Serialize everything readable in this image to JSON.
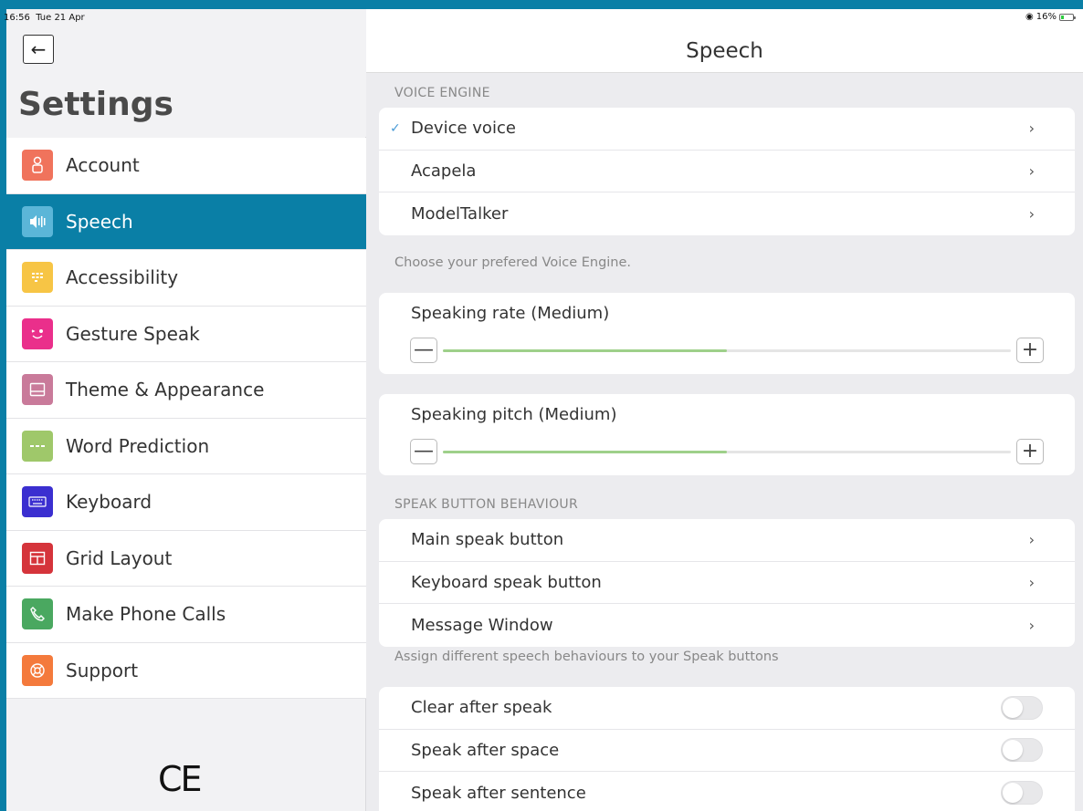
{
  "status_bar": {
    "time": "16:56",
    "date": "Tue 21 Apr",
    "battery": "16%",
    "wifi_icon": "wifi-icon"
  },
  "sidebar": {
    "title": "Settings",
    "items": [
      {
        "label": "Account",
        "icon": "person-icon",
        "color": "#f0735c",
        "active": false
      },
      {
        "label": "Speech",
        "icon": "speaker-icon",
        "color": "#5bb6d8",
        "active": true
      },
      {
        "label": "Accessibility",
        "icon": "grid-dots-icon",
        "color": "#f7c545",
        "active": false
      },
      {
        "label": "Gesture Speak",
        "icon": "wink-face-icon",
        "color": "#ea2f8b",
        "active": false
      },
      {
        "label": "Theme & Appearance",
        "icon": "window-icon",
        "color": "#c97a9a",
        "active": false
      },
      {
        "label": "Word Prediction",
        "icon": "dots-icon",
        "color": "#9fc86a",
        "active": false
      },
      {
        "label": "Keyboard",
        "icon": "keyboard-icon",
        "color": "#3b2fd0",
        "active": false
      },
      {
        "label": "Grid Layout",
        "icon": "table-icon",
        "color": "#d5343b",
        "active": false
      },
      {
        "label": "Make Phone Calls",
        "icon": "phone-icon",
        "color": "#4aa860",
        "active": false
      },
      {
        "label": "Support",
        "icon": "lifebuoy-icon",
        "color": "#f47a3c",
        "active": false
      }
    ],
    "ce_mark": "CE"
  },
  "main": {
    "title": "Speech",
    "voice_engine": {
      "section": "VOICE ENGINE",
      "items": [
        {
          "label": "Device voice",
          "checked": true
        },
        {
          "label": "Acapela",
          "checked": false
        },
        {
          "label": "ModelTalker",
          "checked": false
        }
      ],
      "caption": "Choose your prefered Voice Engine."
    },
    "speaking_rate": {
      "label": "Speaking rate (Medium)",
      "level": 0.5
    },
    "speaking_pitch": {
      "label": "Speaking pitch (Medium)",
      "level": 0.5
    },
    "speak_button": {
      "section": "SPEAK BUTTON BEHAVIOUR",
      "items": [
        {
          "label": "Main speak button"
        },
        {
          "label": "Keyboard speak button"
        },
        {
          "label": "Message Window"
        }
      ],
      "caption": "Assign different speech behaviours to your Speak buttons"
    },
    "toggles": [
      {
        "label": "Clear after speak",
        "on": false
      },
      {
        "label": "Speak after space",
        "on": false
      },
      {
        "label": "Speak after sentence",
        "on": false
      }
    ],
    "accent_color": "#0a7fa6",
    "slider_color": "#9ed08a"
  }
}
